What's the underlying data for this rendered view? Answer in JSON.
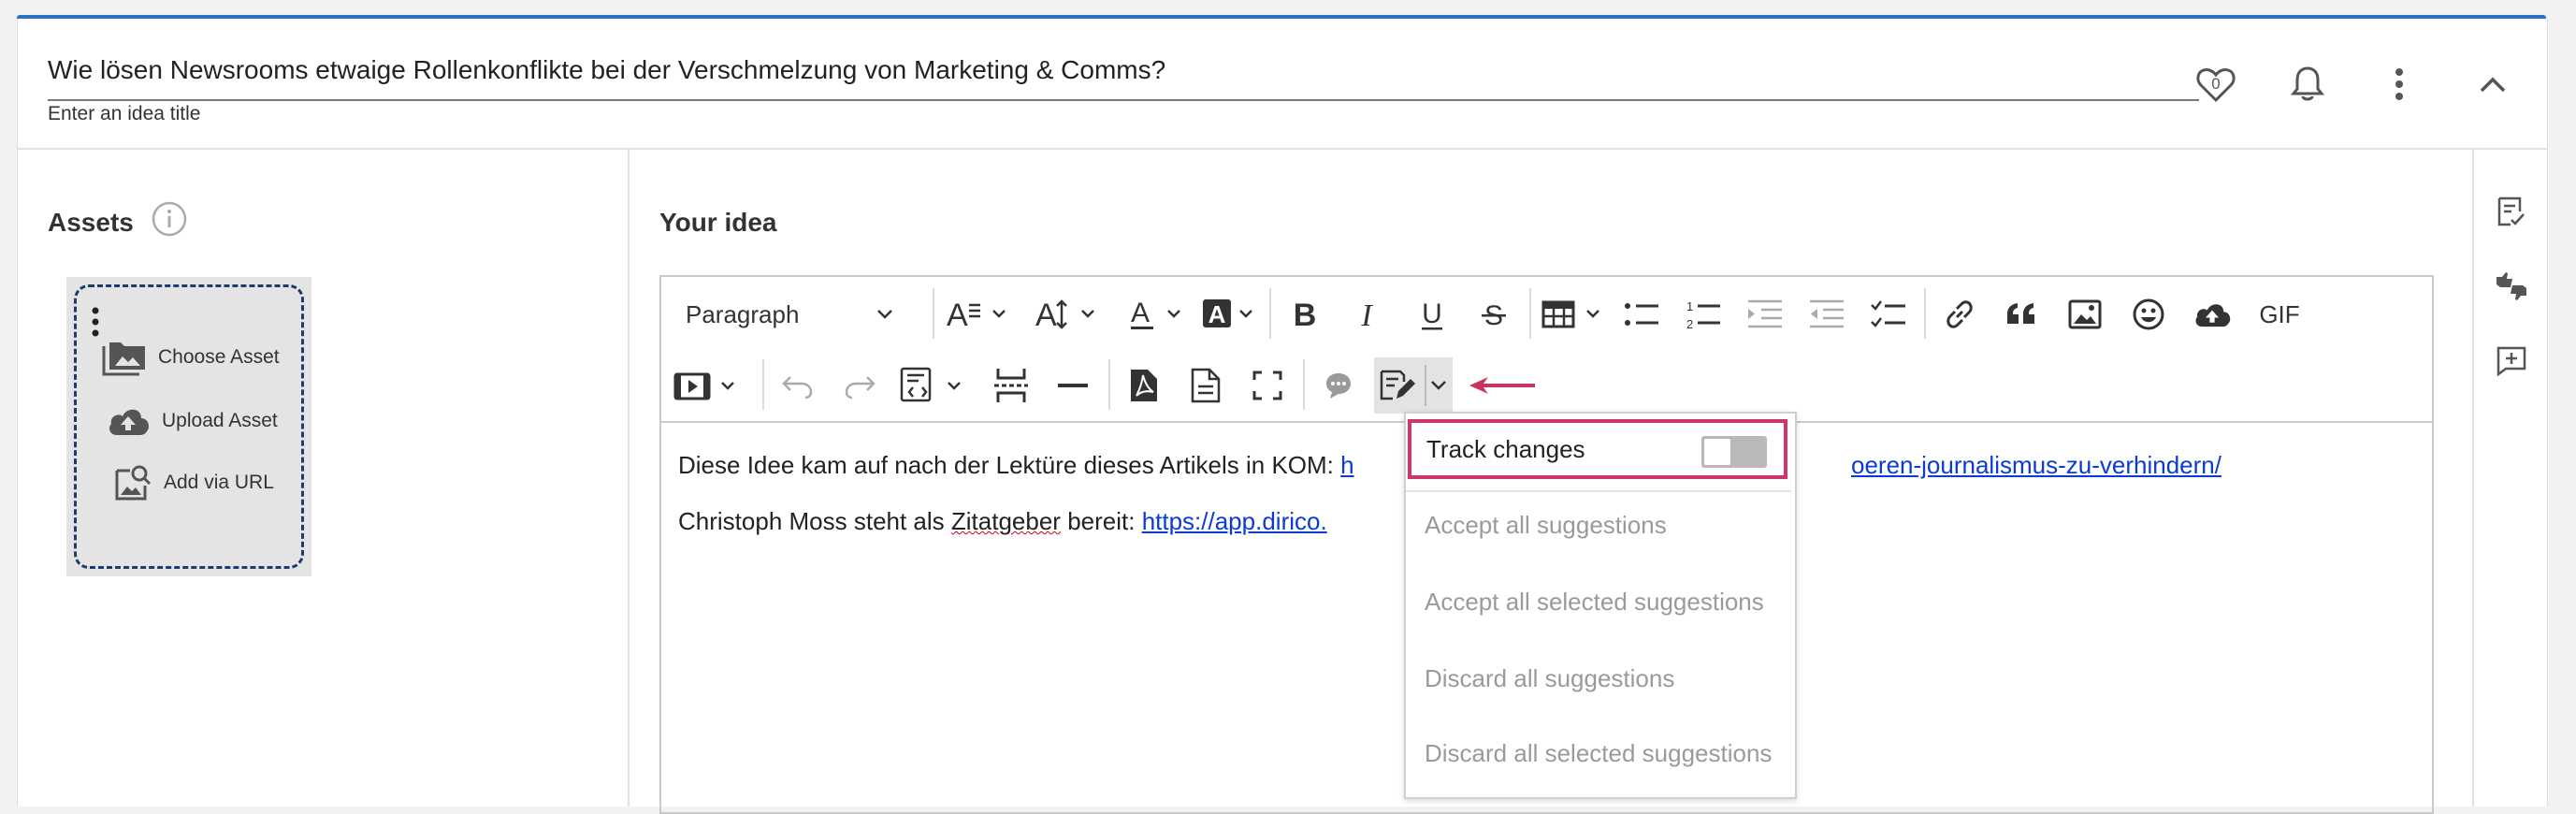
{
  "header": {
    "title_value": "Wie lösen Newsrooms etwaige Rollenkonflikte bei der Verschmelzung von Marketing & Comms?",
    "title_help": "Enter an idea title",
    "like_count": "0"
  },
  "assets": {
    "heading": "Assets",
    "choose_label": "Choose Asset",
    "upload_label": "Upload Asset",
    "url_label": "Add via URL"
  },
  "editor": {
    "heading": "Your idea",
    "paragraph_label": "Paragraph",
    "gif_label": "GIF",
    "line1_prefix": "Diese Idee kam auf nach der Lektüre dieses Artikels in KOM: ",
    "line1_link_start": "h",
    "line1_link_end": "oeren-journalismus-zu-verhindern/",
    "line2_prefix_a": "Christoph Moss steht als ",
    "line2_squiggle": "Zitatgeber",
    "line2_prefix_b": " bereit: ",
    "line2_link": "https://app.dirico."
  },
  "track_menu": {
    "track_label": "Track changes",
    "toggle_on": false,
    "items": [
      "Accept all suggestions",
      "Accept all selected suggestions",
      "Discard all suggestions",
      "Discard all selected suggestions"
    ]
  },
  "colors": {
    "accent": "#2b72c7",
    "highlight": "#d0356e",
    "link": "#0b3bd6",
    "arrow": "#c8355f"
  }
}
